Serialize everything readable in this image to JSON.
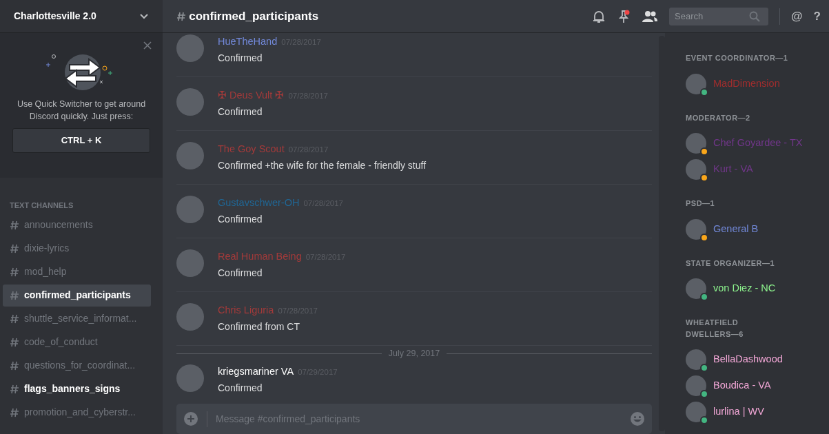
{
  "server": {
    "name": "Charlottesville 2.0"
  },
  "quick_switcher": {
    "text": "Use Quick Switcher to get around Discord quickly. Just press:",
    "shortcut": "CTRL + K"
  },
  "channel_section": "TEXT CHANNELS",
  "channels": [
    {
      "name": "announcements",
      "selected": false,
      "unread": false
    },
    {
      "name": "dixie-lyrics",
      "selected": false,
      "unread": false
    },
    {
      "name": "mod_help",
      "selected": false,
      "unread": false
    },
    {
      "name": "confirmed_participants",
      "selected": true,
      "unread": false
    },
    {
      "name": "shuttle_service_informat...",
      "selected": false,
      "unread": false
    },
    {
      "name": "code_of_conduct",
      "selected": false,
      "unread": false
    },
    {
      "name": "questions_for_coordinat...",
      "selected": false,
      "unread": false
    },
    {
      "name": "flags_banners_signs",
      "selected": false,
      "unread": true
    },
    {
      "name": "promotion_and_cyberstr...",
      "selected": false,
      "unread": false
    }
  ],
  "header": {
    "channel": "confirmed_participants",
    "pins_unread": true,
    "search_placeholder": "Search",
    "mention": "@",
    "help": "?"
  },
  "messages": [
    {
      "kind": "message",
      "author": "HueTheHand",
      "color": "#7289da",
      "time": "07/28/2017",
      "text": "Confirmed"
    },
    {
      "kind": "message",
      "author": "✠ Deus Vult ✠",
      "color": "#a33a3a",
      "time": "07/28/2017",
      "text": "Confirmed"
    },
    {
      "kind": "message",
      "author": "The Goy Scout",
      "color": "#a33a3a",
      "time": "07/28/2017",
      "text": "Confirmed +the wife for the female - friendly stuff"
    },
    {
      "kind": "message",
      "author": "Gustavschwer-OH",
      "color": "#206694",
      "time": "07/28/2017",
      "text": "Confirmed"
    },
    {
      "kind": "message",
      "author": "Real Human Being",
      "color": "#a33a3a",
      "time": "07/28/2017",
      "text": "Confirmed"
    },
    {
      "kind": "message",
      "author": "Chris Liguria",
      "color": "#a33a3a",
      "time": "07/28/2017",
      "text": "Confirmed from CT"
    },
    {
      "kind": "date",
      "text": "July 29, 2017"
    },
    {
      "kind": "message",
      "author": "kriegsmariner VA",
      "color": "#ffffff",
      "time": "07/29/2017",
      "text": "Confirmed"
    }
  ],
  "composer": {
    "placeholder": "Message #confirmed_participants"
  },
  "member_groups": [
    {
      "title": "EVENT COORDINATOR—1",
      "members": [
        {
          "name": "MadDimension",
          "color": "#a12d2d",
          "status_dot": {
            "color": "#43b581"
          }
        }
      ]
    },
    {
      "title": "MODERATOR—2",
      "members": [
        {
          "name": "Chef Goyardee - TX",
          "color": "#71368a",
          "status_dot": {
            "color": "#faa61a"
          }
        },
        {
          "name": "Kurt - VA",
          "color": "#71368a",
          "status_dot": {
            "color": "#faa61a"
          }
        }
      ]
    },
    {
      "title": "PSD—1",
      "members": [
        {
          "name": "General B",
          "color": "#7289da",
          "status_dot": {
            "color": "#faa61a"
          }
        }
      ]
    },
    {
      "title": "STATE ORGANIZER—1",
      "members": [
        {
          "name": "von Diez - NC",
          "color": "#8ef58e",
          "status_dot": {
            "color": "#43b581"
          }
        }
      ]
    },
    {
      "title": "WHEATFIELD DWELLERS—6",
      "members": [
        {
          "name": "BellaDashwood",
          "color": "#f4a8d8",
          "status_dot": {
            "color": "#43b581"
          }
        },
        {
          "name": "Boudica - VA",
          "color": "#f4a8d8",
          "status_dot": {
            "color": "#43b581"
          }
        },
        {
          "name": "lurlina | WV",
          "color": "#f4a8d8",
          "status_dot": {
            "color": "#43b581"
          }
        }
      ]
    }
  ]
}
